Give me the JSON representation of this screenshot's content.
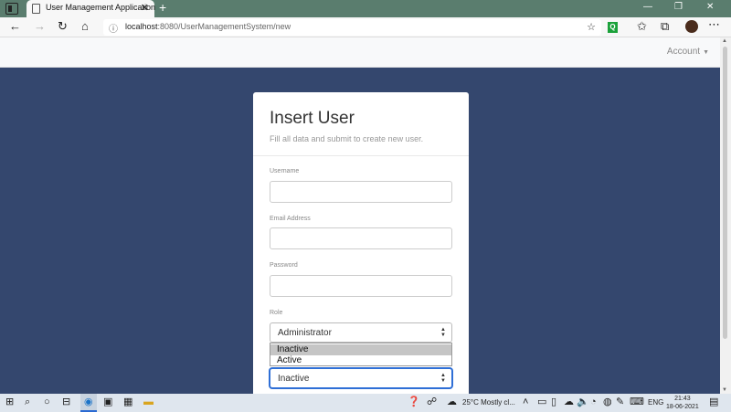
{
  "browser": {
    "tab_title": "User Management Application",
    "tab_close": "✕",
    "new_tab": "+",
    "url_host": "localhost",
    "url_rest": ":8080/UserManagementSystem/new",
    "window": {
      "minimize": "—",
      "restore": "❐",
      "close": "✕"
    },
    "extension_label": "Q"
  },
  "navbar": {
    "account_label": "Account"
  },
  "form": {
    "title": "Insert User",
    "subtitle": "Fill all data and submit to create new user.",
    "fields": [
      {
        "label": "Username",
        "value": ""
      },
      {
        "label": "Email Address",
        "value": ""
      },
      {
        "label": "Password",
        "value": ""
      }
    ],
    "role": {
      "label": "Role",
      "selected": "Administrator"
    },
    "status": {
      "selected": "Inactive",
      "options": [
        "Inactive",
        "Active"
      ],
      "highlighted": "Inactive"
    }
  },
  "taskbar": {
    "weather": "25°C  Mostly cl...",
    "language": "ENG",
    "time": "21:43",
    "date": "18-06-2021"
  },
  "icons": {
    "window_menu": "tab-actions-icon",
    "back": "back-arrow-icon",
    "forward": "forward-arrow-icon",
    "refresh": "refresh-icon",
    "home": "home-icon",
    "info": "info-icon",
    "favorite": "favorite-star-icon",
    "collections": "collections-icon",
    "more": "more-icon",
    "start": "windows-start-icon",
    "search": "search-icon"
  },
  "colors": {
    "page_background": "#34476e",
    "tab_bar": "#5a7d6e",
    "focus_border": "#2f6fd6"
  }
}
